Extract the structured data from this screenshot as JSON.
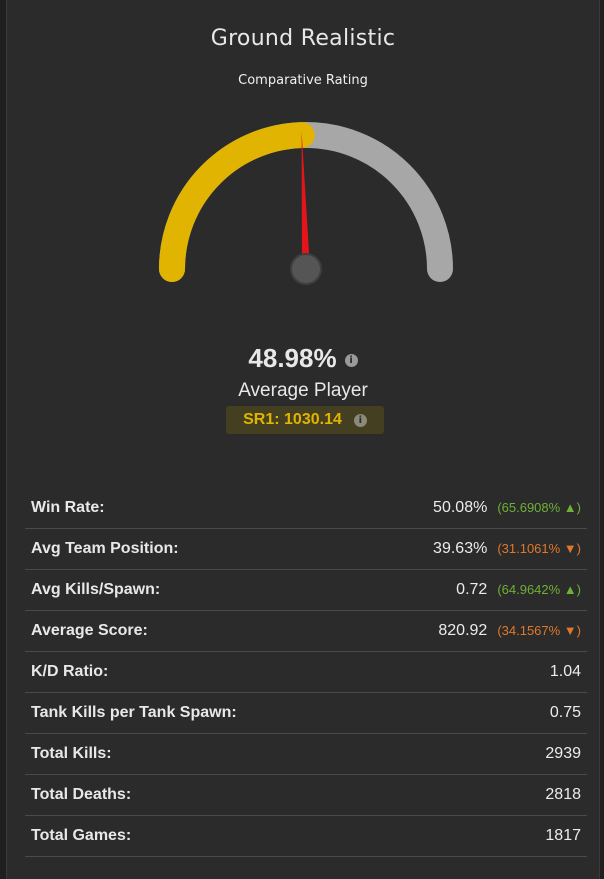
{
  "header": {
    "title": "Ground Realistic",
    "subtitle": "Comparative Rating"
  },
  "gauge": {
    "value_fraction": 0.4898,
    "fill_color": "#e0b400",
    "track_color": "#a7a7a7",
    "needle_color": "#e3151a"
  },
  "rating": {
    "percent": "48.98%",
    "player_label": "Average Player",
    "sr1": "SR1: 1030.14",
    "info_icon": "info-icon"
  },
  "stats": [
    {
      "label": "Win Rate:",
      "value": "50.08%",
      "delta": "(65.6908% ▲)",
      "trend": "up"
    },
    {
      "label": "Avg Team Position:",
      "value": "39.63%",
      "delta": "(31.1061% ▼)",
      "trend": "down"
    },
    {
      "label": "Avg Kills/Spawn:",
      "value": "0.72",
      "delta": "(64.9642% ▲)",
      "trend": "up"
    },
    {
      "label": "Average Score:",
      "value": "820.92",
      "delta": "(34.1567% ▼)",
      "trend": "down"
    },
    {
      "label": "K/D Ratio:",
      "value": "1.04"
    },
    {
      "label": "Tank Kills per Tank Spawn:",
      "value": "0.75"
    },
    {
      "label": "Total Kills:",
      "value": "2939"
    },
    {
      "label": "Total Deaths:",
      "value": "2818"
    },
    {
      "label": "Total Games:",
      "value": "1817"
    }
  ]
}
